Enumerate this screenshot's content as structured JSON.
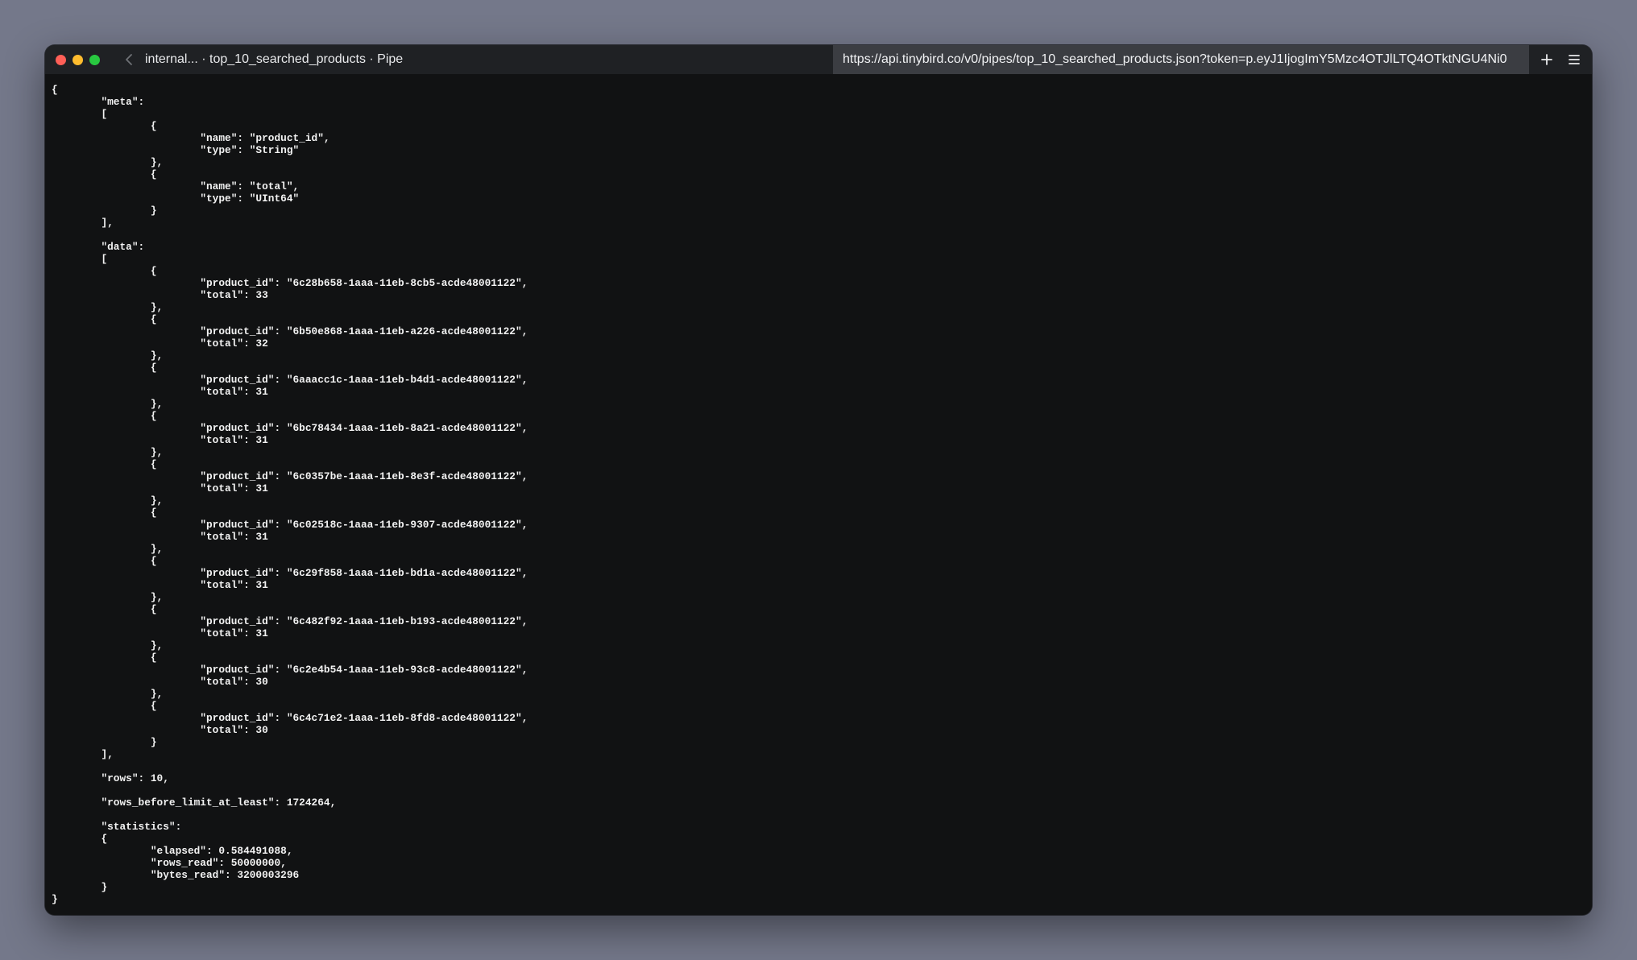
{
  "window": {
    "tab_title": "internal... · top_10_searched_products · Pipe",
    "url": "https://api.tinybird.co/v0/pipes/top_10_searched_products.json?token=p.eyJ1IjogImY5Mzc4OTJlLTQ4OTktNGU4Ni0"
  },
  "response": {
    "meta": [
      {
        "name": "product_id",
        "type": "String"
      },
      {
        "name": "total",
        "type": "UInt64"
      }
    ],
    "data": [
      {
        "product_id": "6c28b658-1aaa-11eb-8cb5-acde48001122",
        "total": 33
      },
      {
        "product_id": "6b50e868-1aaa-11eb-a226-acde48001122",
        "total": 32
      },
      {
        "product_id": "6aaacc1c-1aaa-11eb-b4d1-acde48001122",
        "total": 31
      },
      {
        "product_id": "6bc78434-1aaa-11eb-8a21-acde48001122",
        "total": 31
      },
      {
        "product_id": "6c0357be-1aaa-11eb-8e3f-acde48001122",
        "total": 31
      },
      {
        "product_id": "6c02518c-1aaa-11eb-9307-acde48001122",
        "total": 31
      },
      {
        "product_id": "6c29f858-1aaa-11eb-bd1a-acde48001122",
        "total": 31
      },
      {
        "product_id": "6c482f92-1aaa-11eb-b193-acde48001122",
        "total": 31
      },
      {
        "product_id": "6c2e4b54-1aaa-11eb-93c8-acde48001122",
        "total": 30
      },
      {
        "product_id": "6c4c71e2-1aaa-11eb-8fd8-acde48001122",
        "total": 30
      }
    ],
    "rows": 10,
    "rows_before_limit_at_least": 1724264,
    "statistics": {
      "elapsed": "0.584491088",
      "rows_read": 50000000,
      "bytes_read": 3200003296
    }
  },
  "icons": {
    "back": "chevron-left-icon",
    "new_tab": "plus-icon",
    "menu": "hamburger-menu-icon"
  },
  "colors": {
    "close": "#ff5f57",
    "minimize": "#febc2e",
    "maximize": "#28c840",
    "background": "#111213",
    "text": "#f2f2f2"
  }
}
